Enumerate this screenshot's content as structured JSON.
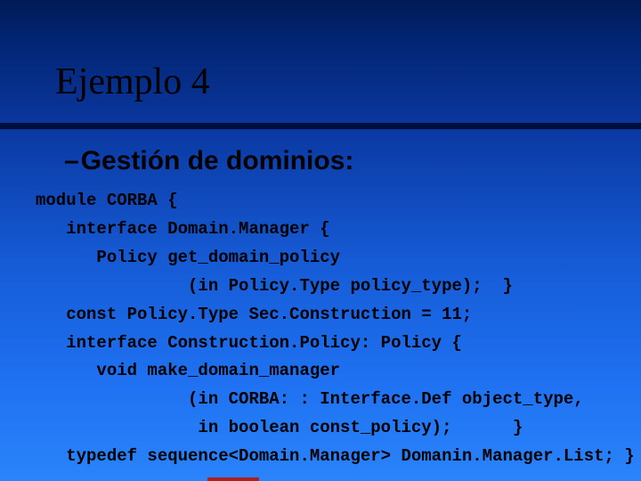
{
  "slide": {
    "title": "Ejemplo 4",
    "subtitle_dash": "–",
    "subtitle": "Gestión de dominios:",
    "code": {
      "l1": "module CORBA {",
      "l2": "   interface Domain.Manager {",
      "l3": "      Policy get_domain_policy",
      "l4": "               (in Policy.Type policy_type);  }",
      "l5": "   const Policy.Type Sec.Construction = 11;",
      "l6": "   interface Construction.Policy: Policy {",
      "l7": "      void make_domain_manager",
      "l8": "               (in CORBA: : Interface.Def object_type,",
      "l9": "                in boolean const_policy);      }",
      "l10": "   typedef sequence<Domain.Manager> Domanin.Manager.List; }"
    }
  }
}
